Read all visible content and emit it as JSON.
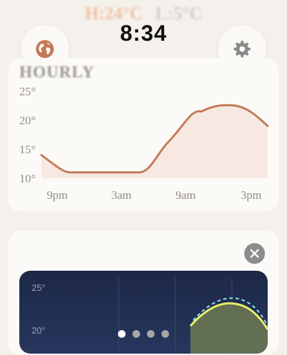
{
  "header": {
    "temp_high": "H:24°C",
    "temp_low": "L:5°C",
    "time": "8:34"
  },
  "buttons": {
    "globe": "globe-icon",
    "settings": "gear-icon"
  },
  "hourly": {
    "title": "HOURLY",
    "y_ticks": [
      "25°",
      "20°",
      "15°",
      "10°"
    ],
    "x_ticks": [
      "9pm",
      "3am",
      "9am",
      "3pm"
    ]
  },
  "detail_chart": {
    "y_ticks": [
      "25°",
      "20°"
    ]
  },
  "pagination": {
    "count": 4,
    "active": 0
  },
  "colors": {
    "accent": "#c47a55",
    "fill": "#f7e8e1",
    "dark_bg": "#1f2a4a",
    "line_yellow": "#e8f06a",
    "line_cyan": "#8fe6f2"
  },
  "chart_data": {
    "type": "area",
    "title": "HOURLY",
    "x": [
      "9pm",
      "3am",
      "9am",
      "3pm"
    ],
    "series": [
      {
        "values": [
          14,
          11,
          11,
          22.5
        ]
      }
    ],
    "ylim": [
      10,
      25
    ]
  }
}
